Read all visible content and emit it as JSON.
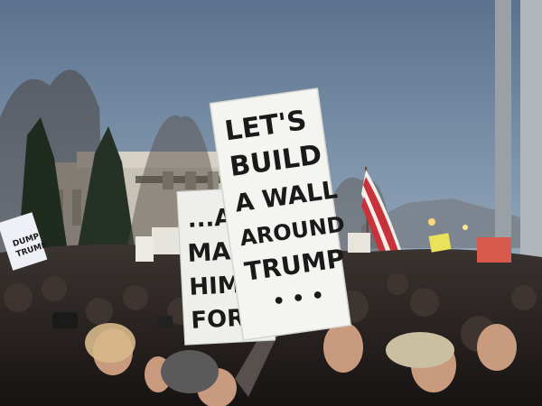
{
  "scene": {
    "colors": {
      "sky_top": "#5f7691",
      "sky_bottom": "#b8c7d3",
      "building": "#c9c4b8",
      "trees": "#2b3a2a",
      "crowd": "#2a2522",
      "sign_paper": "#f2f2ee",
      "sign_ink": "#1a1a1a",
      "flag_red": "#c8323a",
      "flag_white": "#f3efe9"
    },
    "main_sign": {
      "lines": [
        "LET'S",
        "BUILD",
        "A WALL",
        "AROUND",
        "TRUMP",
        "• • •"
      ]
    },
    "second_sign": {
      "lines": [
        "...AN",
        "MAKE",
        "HIM PA",
        "FOR"
      ]
    },
    "left_sign": {
      "lines": [
        "DUMP",
        "TRUMP"
      ]
    },
    "small_signs": [
      "",
      "",
      ""
    ]
  }
}
